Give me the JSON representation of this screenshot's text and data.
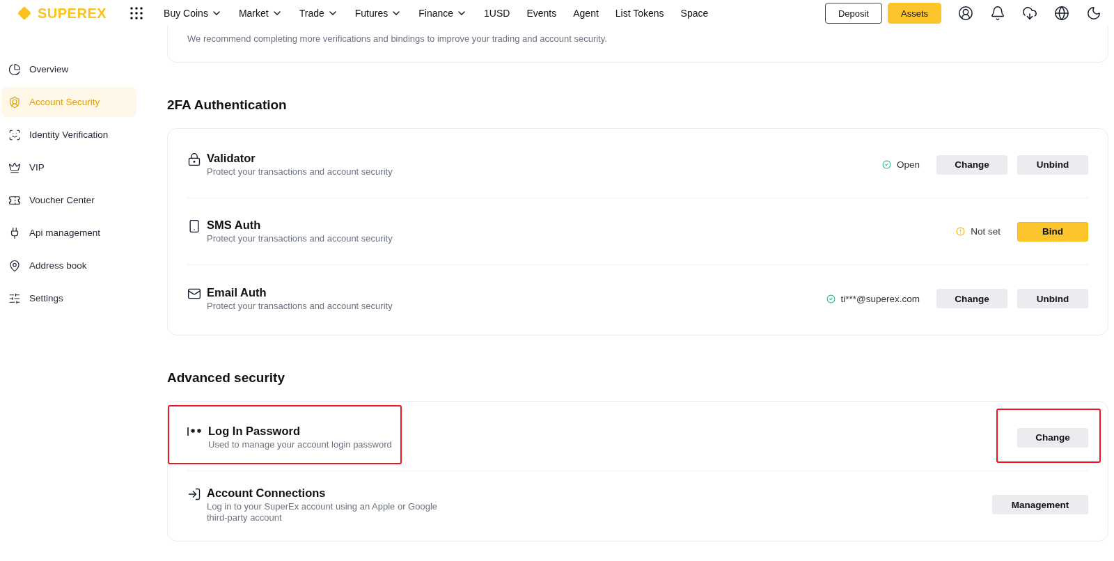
{
  "header": {
    "logo": "SUPEREX",
    "nav": [
      {
        "label": "Buy Coins",
        "dropdown": true
      },
      {
        "label": "Market",
        "dropdown": true
      },
      {
        "label": "Trade",
        "dropdown": true
      },
      {
        "label": "Futures",
        "dropdown": true
      },
      {
        "label": "Finance",
        "dropdown": true
      },
      {
        "label": "1USD",
        "dropdown": false
      },
      {
        "label": "Events",
        "dropdown": false
      },
      {
        "label": "Agent",
        "dropdown": false
      },
      {
        "label": "List Tokens",
        "dropdown": false
      },
      {
        "label": "Space",
        "dropdown": false
      }
    ],
    "buttons": [
      {
        "label": "Deposit",
        "kind": "outline"
      },
      {
        "label": "Assets",
        "kind": "primary"
      }
    ]
  },
  "sidebar": {
    "items": [
      {
        "label": "Overview",
        "selected": false
      },
      {
        "label": "Account Security",
        "selected": true
      },
      {
        "label": "Identity Verification",
        "selected": false
      },
      {
        "label": "VIP",
        "selected": false
      },
      {
        "label": "Voucher Center",
        "selected": false
      },
      {
        "label": "Api management",
        "selected": false
      },
      {
        "label": "Address book",
        "selected": false
      },
      {
        "label": "Settings",
        "selected": false
      }
    ]
  },
  "notice": "We recommend completing more verifications and bindings to improve your trading and account security.",
  "sections": [
    {
      "title": "2FA Authentication",
      "rows": [
        {
          "title": "Validator",
          "description": "Protect your transactions and account security",
          "status": {
            "kind": "ok",
            "text": "Open"
          },
          "buttons": [
            {
              "label": "Change",
              "kind": "secondary"
            },
            {
              "label": "Unbind",
              "kind": "secondary"
            }
          ],
          "highlighted": false
        },
        {
          "title": "SMS Auth",
          "description": "Protect your transactions and account security",
          "status": {
            "kind": "warning",
            "text": "Not set"
          },
          "buttons": [
            {
              "label": "Bind",
              "kind": "primary"
            }
          ],
          "highlighted": false
        },
        {
          "title": "Email Auth",
          "description": "Protect your transactions and account security",
          "status": {
            "kind": "ok",
            "text": "ti***@superex.com"
          },
          "buttons": [
            {
              "label": "Change",
              "kind": "secondary"
            },
            {
              "label": "Unbind",
              "kind": "secondary"
            }
          ],
          "highlighted": false
        }
      ]
    },
    {
      "title": "Advanced security",
      "rows": [
        {
          "title": "Log In Password",
          "description": "Used to manage your account login password",
          "buttons": [
            {
              "label": "Change",
              "kind": "secondary"
            }
          ],
          "highlighted": true
        },
        {
          "title": "Account Connections",
          "description": "Log in to your SuperEx account using an Apple or Google third-party account",
          "buttons": [
            {
              "label": "Management",
              "kind": "secondary"
            }
          ],
          "highlighted": false
        }
      ]
    }
  ]
}
